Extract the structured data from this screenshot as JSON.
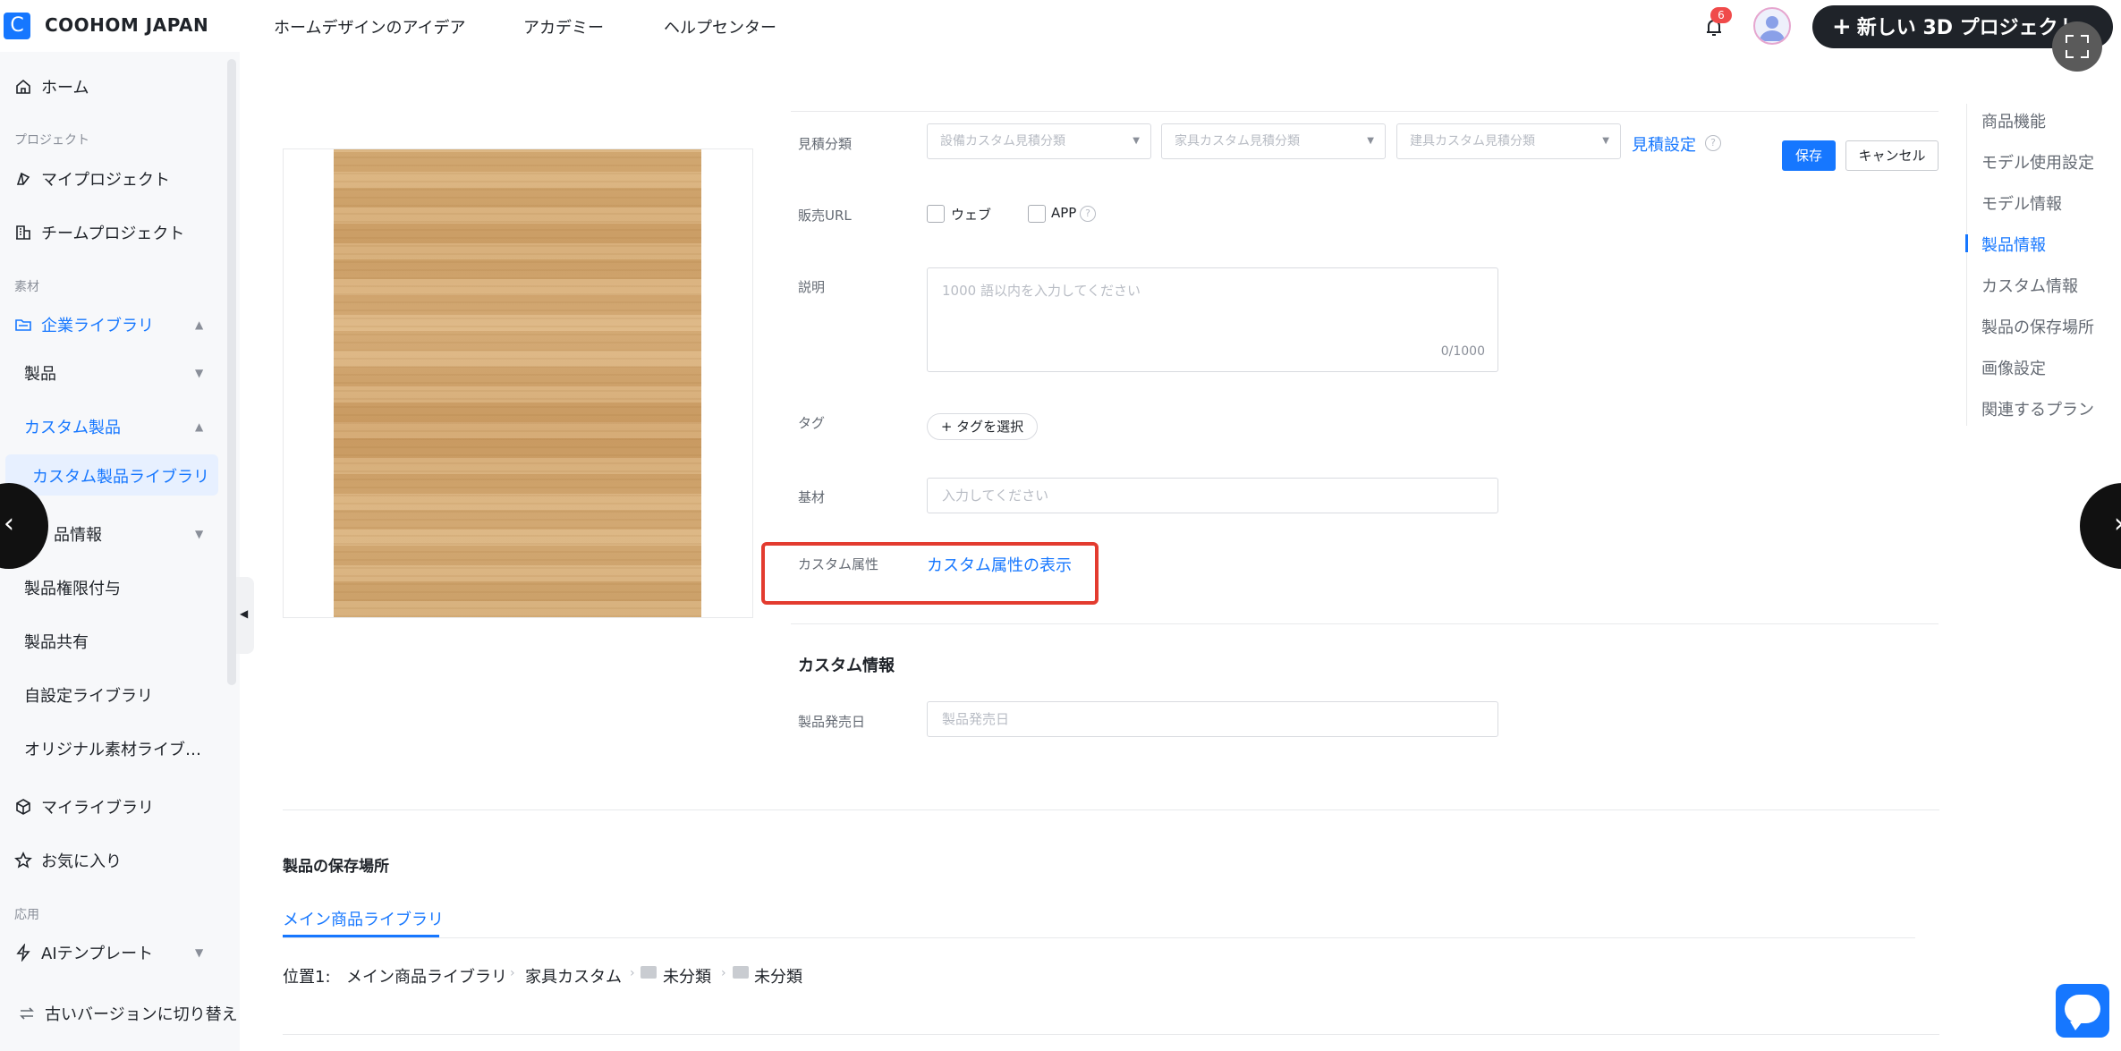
{
  "header": {
    "logo_letter": "C",
    "brand": "COOHOM JAPAN",
    "nav": [
      "ホームデザインのアイデア",
      "アカデミー",
      "ヘルプセンター"
    ],
    "notification_count": "6",
    "new_project_label": "新しい 3D プロジェクト"
  },
  "sidebar": {
    "home": "ホーム",
    "section_project": "プロジェクト",
    "my_project": "マイプロジェクト",
    "team_project": "チームプロジェクト",
    "section_material": "素材",
    "enterprise_library": "企業ライブラリ",
    "products": "製品",
    "custom_products": "カスタム製品",
    "custom_product_library": "カスタム製品ライブラリ",
    "product_info": "品情報",
    "product_permission": "製品権限付与",
    "product_share": "製品共有",
    "custom_library": "自設定ライブラリ",
    "original_material": "オリジナル素材ライブ…",
    "my_library": "マイライブラリ",
    "favorites": "お気に入り",
    "section_app": "応用",
    "ai_template": "AIテンプレート",
    "switch_old": "古いバージョンに切り替え"
  },
  "form": {
    "estimate_label": "見積分類",
    "estimate_select_1": "設備カスタム見積分類",
    "estimate_select_2": "家具カスタム見積分類",
    "estimate_select_3": "建具カスタム見積分類",
    "estimate_settings": "見積設定",
    "save": "保存",
    "cancel": "キャンセル",
    "sales_url_label": "販売URL",
    "web_label": "ウェブ",
    "app_label": "APP",
    "description_label": "説明",
    "description_placeholder": "1000 語以内を入力してください",
    "description_count": "0/1000",
    "tag_label": "タグ",
    "tag_select": "タグを選択",
    "base_label": "基材",
    "base_placeholder": "入力してください",
    "custom_attr_label": "カスタム属性",
    "custom_attr_link": "カスタム属性の表示",
    "custom_info_title": "カスタム情報",
    "release_date_label": "製品発売日",
    "release_date_placeholder": "製品発売日"
  },
  "storage": {
    "title": "製品の保存場所",
    "tab": "メイン商品ライブラリ",
    "location_label": "位置1:",
    "path": [
      "メイン商品ライブラリ",
      "家具カスタム",
      "未分類",
      "未分類"
    ]
  },
  "anchors": [
    "商品機能",
    "モデル使用設定",
    "モデル情報",
    "製品情報",
    "カスタム情報",
    "製品の保存場所",
    "画像設定",
    "関連するプラン"
  ],
  "colors": {
    "accent": "#1677ff",
    "highlight_box": "#e33b2f"
  }
}
